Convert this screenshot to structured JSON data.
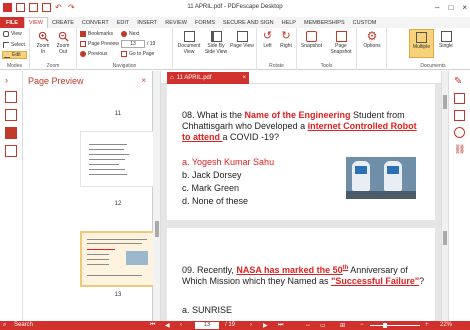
{
  "titlebar": {
    "title": "11 APRIL.pdf - PDFescape Desktop"
  },
  "menu": {
    "items": [
      "FILE",
      "VIEW",
      "CREATE",
      "CONVERT",
      "EDIT",
      "INSERT",
      "REVIEW",
      "FORMS",
      "SECURE AND SIGN",
      "HELP",
      "MEMBERSHIPS",
      "CUSTOM"
    ],
    "active": "VIEW"
  },
  "ribbon": {
    "modes": {
      "view": "View",
      "select": "Select",
      "edit": "Edit",
      "group": "Modes"
    },
    "zoom": {
      "zoom_in": "Zoom In",
      "zoom_out": "Zoom Out",
      "group": "Zoom"
    },
    "navigation": {
      "bookmarks": "Bookmarks",
      "page_preview": "Page Preview",
      "previous": "Previous",
      "next": "Next",
      "page_value": "13",
      "page_total": "/ 19",
      "go_to_page": "Go to Page",
      "group": "Navigation"
    },
    "pageview": {
      "document_view": "Document View",
      "side_by_side": "Side By Side View",
      "page_view": "Page View"
    },
    "rotate": {
      "left": "Left",
      "right": "Right",
      "group": "Rotate"
    },
    "tools": {
      "snapshot": "Snapshot",
      "page_snapshot": "Page Snapshot",
      "group": "Tools"
    },
    "options": {
      "label": "Options"
    },
    "documents": {
      "multiple": "Multiple",
      "single": "Single",
      "group": "Documents"
    }
  },
  "preview": {
    "title": "Page Preview",
    "pages": [
      {
        "num": "11"
      },
      {
        "num": "12"
      },
      {
        "num": "13"
      }
    ]
  },
  "tab": {
    "label": "11 APRIL.pdf"
  },
  "document": {
    "q8": {
      "pre": "08. What is the ",
      "hl1": "Name of the Engineering",
      "mid": " Student from Chhattisgarh who Developed a ",
      "hl2": "internet Controlled Robot to attend ",
      "post": "a COVID -19?"
    },
    "q8_options": [
      "a.  Yogesh Kumar Sahu",
      "b.  Jack Dorsey",
      "c.  Mark Green",
      "d.  None of these"
    ],
    "q9": {
      "pre": "09. Recently, ",
      "hl1": "NASA has marked the 50",
      "sup": "th",
      "mid": " Anniversary of Which Mission which they Named as  ",
      "hl2": "\"Successful Failure\"",
      "post": "?"
    },
    "q9_options": [
      "a.  SUNRISE"
    ]
  },
  "status": {
    "search": "Search",
    "page": "13",
    "total": "/ 19",
    "zoom": "22%"
  }
}
